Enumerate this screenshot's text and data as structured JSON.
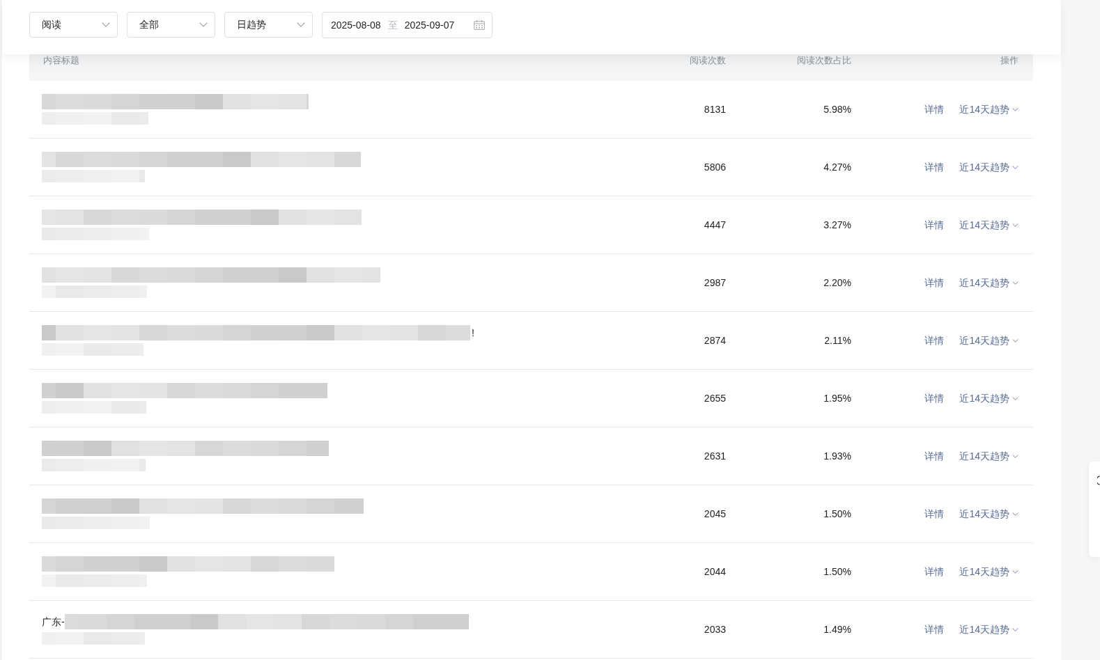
{
  "filters": [
    "阅读",
    "全部",
    "日趋势"
  ],
  "date_range": {
    "start": "2025-08-08",
    "separator": "至",
    "end": "2025-09-07"
  },
  "table": {
    "columns": [
      "内容标题",
      "阅读次数",
      "阅读次数占比",
      "操作"
    ],
    "rows": [
      {
        "reads": "8131",
        "share": "5.98%",
        "actions": [
          {
            "kind": "link",
            "label": "详情"
          },
          {
            "kind": "dropdown",
            "label": "近14天趋势"
          }
        ]
      },
      {
        "reads": "5806",
        "share": "4.27%",
        "actions": [
          {
            "kind": "link",
            "label": "详情"
          },
          {
            "kind": "dropdown",
            "label": "近14天趋势"
          }
        ]
      },
      {
        "reads": "4447",
        "share": "3.27%",
        "actions": [
          {
            "kind": "link",
            "label": "详情"
          },
          {
            "kind": "dropdown",
            "label": "近14天趋势"
          }
        ]
      },
      {
        "reads": "2987",
        "share": "2.20%",
        "actions": [
          {
            "kind": "link",
            "label": "详情"
          },
          {
            "kind": "dropdown",
            "label": "近14天趋势"
          }
        ]
      },
      {
        "title_suffix": "!",
        "reads": "2874",
        "share": "2.11%",
        "actions": [
          {
            "kind": "link",
            "label": "详情"
          },
          {
            "kind": "dropdown",
            "label": "近14天趋势"
          }
        ]
      },
      {
        "reads": "2655",
        "share": "1.95%",
        "actions": [
          {
            "kind": "link",
            "label": "详情"
          },
          {
            "kind": "dropdown",
            "label": "近14天趋势"
          }
        ]
      },
      {
        "reads": "2631",
        "share": "1.93%",
        "actions": [
          {
            "kind": "link",
            "label": "详情"
          },
          {
            "kind": "dropdown",
            "label": "近14天趋势"
          }
        ]
      },
      {
        "reads": "2045",
        "share": "1.50%",
        "actions": [
          {
            "kind": "link",
            "label": "详情"
          },
          {
            "kind": "dropdown",
            "label": "近14天趋势"
          }
        ]
      },
      {
        "reads": "2044",
        "share": "1.50%",
        "actions": [
          {
            "kind": "link",
            "label": "详情"
          },
          {
            "kind": "dropdown",
            "label": "近14天趋势"
          }
        ]
      },
      {
        "title_prefix": "广东-",
        "reads": "2033",
        "share": "1.49%",
        "actions": [
          {
            "kind": "link",
            "label": "详情"
          },
          {
            "kind": "dropdown",
            "label": "近14天趋势"
          }
        ]
      }
    ]
  }
}
